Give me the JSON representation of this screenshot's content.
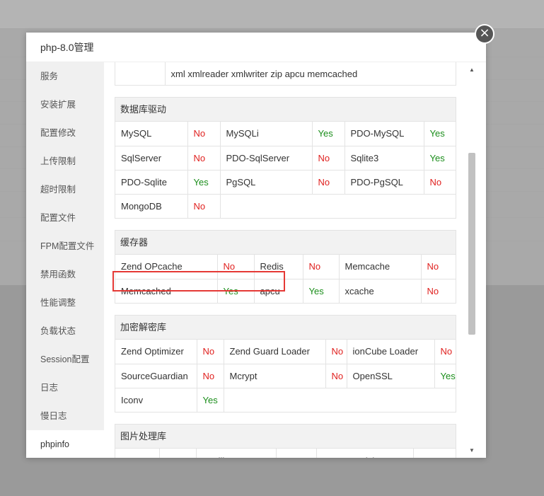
{
  "dialog": {
    "title": "php-8.0管理",
    "close_symbol": "×"
  },
  "sidebar": {
    "items": [
      {
        "label": "服务"
      },
      {
        "label": "安装扩展"
      },
      {
        "label": "配置修改"
      },
      {
        "label": "上传限制"
      },
      {
        "label": "超时限制"
      },
      {
        "label": "配置文件"
      },
      {
        "label": "FPM配置文件"
      },
      {
        "label": "禁用函数"
      },
      {
        "label": "性能调整"
      },
      {
        "label": "负载状态"
      },
      {
        "label": "Session配置"
      },
      {
        "label": "日志"
      },
      {
        "label": "慢日志"
      },
      {
        "label": "phpinfo"
      }
    ],
    "active": "phpinfo"
  },
  "extensions_tail": "xml xmlreader xmlwriter zip apcu memcached",
  "sections": {
    "db": {
      "title": "数据库驱动",
      "rows": [
        [
          {
            "name": "MySQL",
            "status": "No"
          },
          {
            "name": "MySQLi",
            "status": "Yes"
          },
          {
            "name": "PDO-MySQL",
            "status": "Yes"
          }
        ],
        [
          {
            "name": "SqlServer",
            "status": "No"
          },
          {
            "name": "PDO-SqlServer",
            "status": "No"
          },
          {
            "name": "Sqlite3",
            "status": "Yes"
          }
        ],
        [
          {
            "name": "PDO-Sqlite",
            "status": "Yes"
          },
          {
            "name": "PgSQL",
            "status": "No"
          },
          {
            "name": "PDO-PgSQL",
            "status": "No"
          }
        ],
        [
          {
            "name": "MongoDB",
            "status": "No"
          }
        ]
      ]
    },
    "cache": {
      "title": "缓存器",
      "rows": [
        [
          {
            "name": "Zend OPcache",
            "status": "No"
          },
          {
            "name": "Redis",
            "status": "No"
          },
          {
            "name": "Memcache",
            "status": "No"
          }
        ],
        [
          {
            "name": "Memcached",
            "status": "Yes"
          },
          {
            "name": "apcu",
            "status": "Yes"
          },
          {
            "name": "xcache",
            "status": "No"
          }
        ]
      ]
    },
    "crypto": {
      "title": "加密解密库",
      "rows": [
        [
          {
            "name": "Zend Optimizer",
            "status": "No"
          },
          {
            "name": "Zend Guard Loader",
            "status": "No"
          },
          {
            "name": "ionCube Loader",
            "status": "No"
          }
        ],
        [
          {
            "name": "SourceGuardian",
            "status": "No"
          },
          {
            "name": "Mcrypt",
            "status": "No"
          },
          {
            "name": "OpenSSL",
            "status": "Yes"
          }
        ],
        [
          {
            "name": "Iconv",
            "status": "Yes"
          }
        ]
      ]
    },
    "image": {
      "title": "图片处理库",
      "rows": [
        [
          {
            "name": "EXIF",
            "status": "No"
          },
          {
            "name": "GD library",
            "status": "Yes"
          },
          {
            "name": "ImageMagick",
            "status": "No"
          }
        ]
      ]
    }
  },
  "colors": {
    "yes": "#1a8d1a",
    "no": "#e0211f",
    "highlight": "#e53935"
  },
  "icons": {
    "close": "close-icon",
    "scroll_up": "arrow-up-icon",
    "scroll_down": "arrow-down-icon"
  }
}
